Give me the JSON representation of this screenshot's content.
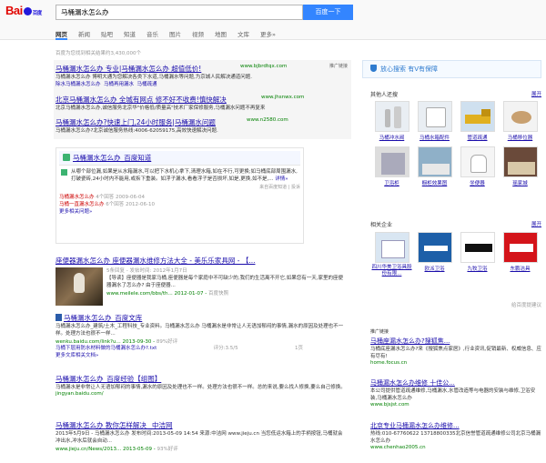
{
  "brand": {
    "logo_left": "Bai",
    "logo_right": "百度"
  },
  "search": {
    "value": "马桶漏水怎么办",
    "button": "百度一下"
  },
  "tabs": [
    "网页",
    "新闻",
    "贴吧",
    "知道",
    "音乐",
    "图片",
    "视频",
    "地图",
    "文库",
    "更多»"
  ],
  "result_count": "百度为您找到相关结果约3,430,000个",
  "ads": {
    "tag": "推广链接",
    "items": [
      {
        "title": "马桶漏水怎么办 专业|马桶漏水怎么办 超值低价!",
        "url": "www.bjbrdtqx.com",
        "desc1": "马桶漏水怎么办 博明大通为您解决各类下水道,马桶漏水等问题,为京城人民解决通道问题.",
        "links": [
          "除水马桶漏水怎么办",
          "马桶再用漏水",
          "马桶疏通"
        ]
      },
      {
        "title": "北京马桶漏水怎么办 全城有网点 修不好不收费!慎快解决",
        "url": "www.jhsnwx.com",
        "desc1": "北京马桶漏水怎么办,诚信服务北京华\"价格低/质量高\"技术厂家保修服务,马桶漏水问题不再复来"
      },
      {
        "title": "马桶漏水怎么办?快速上门,24小时服务|马桶漏水问题",
        "url": "www.n2580.com",
        "desc1": "马桶漏水怎么办?北京诚信服务热线:4006-62059175,高效快速解决问题."
      }
    ]
  },
  "zhidao": {
    "title": "马桶漏水怎么办_百度知道",
    "answer": "从哪个部位漏,如果是从水箱漏水,可以把下水机心拿下,清理水箱,如在不行,可更换;如马桶底部周围漏水,打破瓷砖,24小时内不能用,或拆下重装。如浮子漏水,看看浮子是否损坏,如是,更换,如不是,...",
    "more": "详情»",
    "source": "来自百度知道",
    "report": "投诉",
    "q1": "马桶漏水怎么办",
    "q1_meta": "4个回答 2009-06-04",
    "q2": "马桶一直漏水怎么办",
    "q2_meta": "6个回答 2012-06-10",
    "more_q": "更多相关问题»"
  },
  "results": [
    {
      "title": "座便器漏水怎么办 座便器漏水维修方法大全 - 美乐乐家具网 - 【...",
      "date": "5条回复 - 发帖时间: 2012年1月7日",
      "desc": "【导读】座便器是我家马桶,座便器是每个家庭中不可缺少的,我们的生活离不开它,如果您有一天,家里的座便器漏水了怎么办? 由于座便器...",
      "url": "www.meilele.com/bbs/th... 2012-01-07",
      "snap": "百度快照"
    },
    {
      "title": "马桶漏水怎么办_百度文库",
      "desc": "马桶漏水怎么办_建筑/土木_工程科技_专业资料。马桶漏水怎么办 马桶漏水是非常让人无语加郁闷的事情,漏水的原因及处理也不一样。处理方法也很不一样...",
      "url": "wenku.baidu.com/link?u... 2013-09-30",
      "rating": "89%好评",
      "sub": "马桶下层用防水材料做的马桶漏水怎么办?.txt",
      "pages": "评分:3.5/5",
      "page_num": "1页",
      "more": "更多文库相关文档»"
    },
    {
      "title": "马桶漏水怎么办_百度经验【组图】",
      "desc": "马桶漏水是非常让人无语加郁闷的事情,漏水的原因及处理也不一样。处理方法也很不一样。总的来说,要么找人修换,要么自己修换。",
      "url": "jingyan.baidu.com/"
    },
    {
      "title": "马桶漏水怎么办 教你怎样解决 _中洁网",
      "desc": "2013年5月9日 - 马桶漏水怎么办 发布时间:2013-05-09 14:54 来源:中洁网 www.jieju.cn 当您低运水箱上的手柄按钮,马桶就会冲出水,冲水后就会自动...",
      "url": "www.jieju.cn/News/2013... 2013-05-09",
      "rating": "93%好评"
    }
  ],
  "right": {
    "fx_title": "放心搜索 有V有保障",
    "people_title": "其他人还搜",
    "people_more": "展开",
    "people": [
      "马桶冲水阀",
      "马桶水箱配件",
      "管道疏通",
      "马桶移位器",
      "卫浴柜",
      "橱柜效果图",
      "坐便器",
      "瑶家城"
    ],
    "company_title": "相关企业",
    "company_more": "展开",
    "companies": [
      "四川华美卫浴具股份有限...",
      "欧派卫浴",
      "九牧卫浴",
      "东鹏洁具"
    ],
    "feedback": "给百度提建议",
    "ad_tag": "推广链接",
    "ads": [
      {
        "title": "马桶座漏水怎么办?搜狐焦...",
        "desc": "马桶底座漏水怎么办?来《搜狐焦点家居》,行业资讯,促销最新、权威信息、应有尽有!",
        "url": "home.focus.cn"
      },
      {
        "title": "马桶漏水怎么办维修 十佳公...",
        "desc": "本公司提供管道疏通维修,马桶漏水,水管改造等与电器的安装与维修,卫浴安装,马桶漏水怎么办",
        "url": "www.bjsjst.com"
      },
      {
        "title": "北京专业马桶漏水怎么办维修...",
        "desc": "热线:010-67760622 13718800335北京信誉管道疏通维修公司北京马桶漏水怎么办",
        "url": "www.chenhao2005.cn"
      }
    ]
  },
  "colors": {
    "link": "#1a0dab",
    "url": "#008000",
    "accent": "#3385ff",
    "highlight": "#c00"
  }
}
